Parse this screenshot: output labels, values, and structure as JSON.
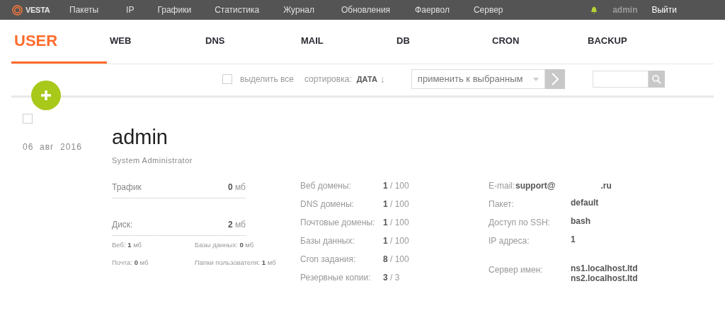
{
  "topbar": {
    "logo": "VESTA",
    "menu": [
      {
        "label": "Пакеты",
        "selected": false
      },
      {
        "label": "IP",
        "selected": false
      },
      {
        "label": "Графики",
        "selected": false
      },
      {
        "label": "Статистика",
        "selected": false
      },
      {
        "label": "Журнал",
        "selected": false
      },
      {
        "label": "Обновления",
        "selected": false
      },
      {
        "label": "Фаервол",
        "selected": false
      },
      {
        "label": "Сервер",
        "selected": false
      }
    ],
    "user": "admin",
    "logout": "Выйти"
  },
  "tabs": [
    {
      "label": "USER",
      "selected": true
    },
    {
      "label": "WEB",
      "selected": false
    },
    {
      "label": "DNS",
      "selected": false
    },
    {
      "label": "MAIL",
      "selected": false
    },
    {
      "label": "DB",
      "selected": false
    },
    {
      "label": "CRON",
      "selected": false
    },
    {
      "label": "BACKUP",
      "selected": false
    }
  ],
  "toolbar": {
    "select_all": {
      "label": "выделить все",
      "checked": false
    },
    "sort_label": "сортировка:",
    "sort_value": "ДАТА",
    "sort_arrow": "↓",
    "action_select": "применить к выбранным"
  },
  "user": {
    "checked": false,
    "date": "06  авг  2016",
    "name": "admin",
    "role": "System Administrator",
    "traffic": {
      "label": "Трафик",
      "value": "**0** мб"
    },
    "disk": {
      "label": "Диск:",
      "value": "**2** мб",
      "details": [
        "Веб: **1** мб",
        "Базы данных: **0** мб",
        "Почта: **0** мб",
        "Папки пользователя: **1** мб"
      ]
    },
    "limits": [
      {
        "label": "Веб домены:",
        "value": "**1** / 100"
      },
      {
        "label": "DNS домены:",
        "value": "**1** / 100"
      },
      {
        "label": "Почтовые домены:",
        "value": "**1** / 100"
      },
      {
        "label": "Базы данных:",
        "value": "**1** / 100"
      },
      {
        "label": "Cron задания:",
        "value": "**8** / 100"
      },
      {
        "label": "Резервные копии:",
        "value": "**3** / 3"
      }
    ],
    "info": [
      {
        "label": "E-mail:",
        "values": [
          "support@",
          ".ru"
        ],
        "kind": "email"
      },
      {
        "label": "Пакет:",
        "values": [
          "default"
        ],
        "kind": "plain"
      },
      {
        "label": "Доступ по SSH:",
        "values": [
          "bash"
        ],
        "kind": "plain"
      },
      {
        "label": "IP адреса:",
        "values": [
          "1"
        ],
        "kind": "plain"
      },
      {
        "label": "Сервер имен:",
        "values": [
          "ns1.localhost.ltd",
          "ns2.localhost.ltd"
        ],
        "kind": "gap"
      }
    ]
  }
}
